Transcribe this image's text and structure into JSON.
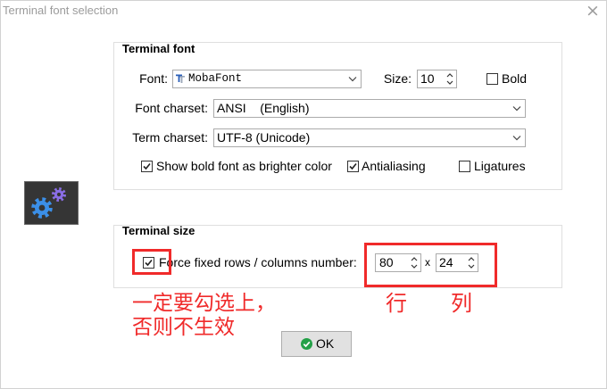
{
  "window": {
    "title": "Terminal font selection",
    "close_glyph": "×"
  },
  "terminal_font": {
    "group_label": "Terminal font",
    "font_label": "Font:",
    "font_value": "MobaFont",
    "size_label": "Size:",
    "size_value": "10",
    "bold": {
      "label": "Bold",
      "checked": false
    },
    "font_charset_label": "Font charset:",
    "font_charset_value": "ANSI    (English)",
    "term_charset_label": "Term charset:",
    "term_charset_value": "UTF-8 (Unicode)",
    "options": [
      {
        "label": "Show bold font as brighter color",
        "checked": true
      },
      {
        "label": "Antialiasing",
        "checked": true
      },
      {
        "label": "Ligatures",
        "checked": false
      }
    ]
  },
  "terminal_size": {
    "group_label": "Terminal size",
    "force_fixed": {
      "label": "Force fixed rows / columns number:",
      "checked": true
    },
    "first_value": "80",
    "separator": "x",
    "second_value": "24"
  },
  "annotations": {
    "note_line_1": "一定要勾选上，",
    "note_line_2": "否则不生效",
    "under_first_value": "行",
    "under_second_value": "列"
  },
  "ok_button": {
    "label": "OK"
  },
  "icons": {
    "close": "close-icon",
    "font_type": "truetype-font-icon",
    "dropdown": "chevron-down-icon",
    "spinner": "spin-arrows-icon",
    "settings": "gears-icon",
    "ok": "green-check-icon"
  },
  "colors": {
    "annotation_red": "#f02a2a",
    "ok_icon_green": "#23a047",
    "gear_blue": "#3b8fe8",
    "gear_purple": "#8a6ee6",
    "icon_background": "#353535"
  }
}
